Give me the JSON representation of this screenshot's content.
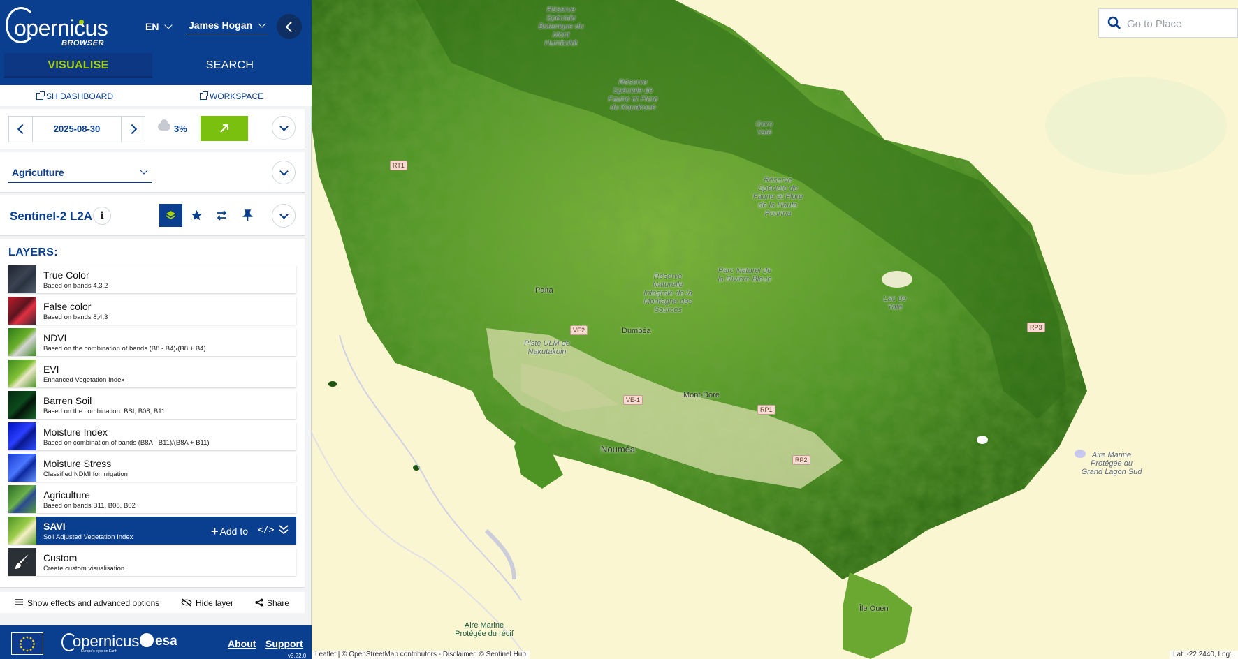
{
  "header": {
    "logo_text": "opernicus",
    "logo_sub": "BROWSER",
    "language": "EN",
    "user": "James Hogan"
  },
  "tabs": [
    {
      "label": "VISUALISE",
      "active": true
    },
    {
      "label": "SEARCH",
      "active": false
    }
  ],
  "links": {
    "dashboard": "SH DASHBOARD",
    "workspace": "WORKSPACE"
  },
  "date_picker": {
    "date": "2025-08-30",
    "cloud_cover": "3%"
  },
  "theme": {
    "selected": "Agriculture"
  },
  "dataset": {
    "name": "Sentinel-2 L2A",
    "info_icon": "i"
  },
  "layers": {
    "title": "LAYERS:",
    "items": [
      {
        "name": "True Color",
        "desc": "Based on bands 4,3,2"
      },
      {
        "name": "False color",
        "desc": "Based on bands 8,4,3"
      },
      {
        "name": "NDVI",
        "desc": "Based on the combination of bands (B8 - B4)/(B8 + B4)"
      },
      {
        "name": "EVI",
        "desc": "Enhanced Vegetation Index"
      },
      {
        "name": "Barren Soil",
        "desc": "Based on the combination: BSI, B08, B11"
      },
      {
        "name": "Moisture Index",
        "desc": "Based on combination of bands (B8A - B11)/(B8A + B11)"
      },
      {
        "name": "Moisture Stress",
        "desc": "Classified NDMI for irrigation"
      },
      {
        "name": "Agriculture",
        "desc": "Based on bands B11, B08, B02"
      },
      {
        "name": "SAVI",
        "desc": "Soil Adjusted Vegetation Index",
        "active": true
      },
      {
        "name": "Custom",
        "desc": "Create custom visualisation"
      }
    ],
    "add_to_label": "Add to",
    "code_icon": "</>"
  },
  "options": {
    "effects": "Show effects and advanced options",
    "hide_layer": "Hide layer",
    "share": "Share"
  },
  "footer": {
    "copernicus": "opernicus",
    "copernicus_sub": "Europe's eyes on Earth",
    "esa": "esa",
    "about": "About",
    "support": "Support",
    "version": "v3.22.0"
  },
  "map": {
    "search_placeholder": "Go to Place",
    "attribution": "Leaflet | © OpenStreetMap contributors - Disclaimer, © Sentinel Hub",
    "coords": "Lat: -22.2440, Lng: ",
    "labels": {
      "reserve1": "Réserve Spéciale Botanique du Mont Humboldt",
      "reserve2": "Réserve Spéciale de Faune et Flore du Kouakoué",
      "reserve3": "Réserve Spéciale de Faune et Flore de la Haute Pourina",
      "reserve4": "Réserve Naturelle Intégrale de la Montagne des Sources",
      "park": "Parc Naturel de la Rivière Bleue",
      "lake": "Lac de Yaté",
      "piste": "Piste ULM de Nakutakoin",
      "aire1": "Aire Marine Protégée du récif",
      "aire2": "Aire Marine Protégée du Grand Lagon Sud",
      "ouen": "Île Ouen",
      "goro": "Goro Yaté",
      "paita": "Païta",
      "dumbea": "Dumbéa",
      "montdore": "Mont-Dore",
      "noumea": "Nouméa"
    },
    "roads": [
      "RT1",
      "VE2",
      "VE-1",
      "RP1",
      "RP2",
      "RP3"
    ]
  }
}
